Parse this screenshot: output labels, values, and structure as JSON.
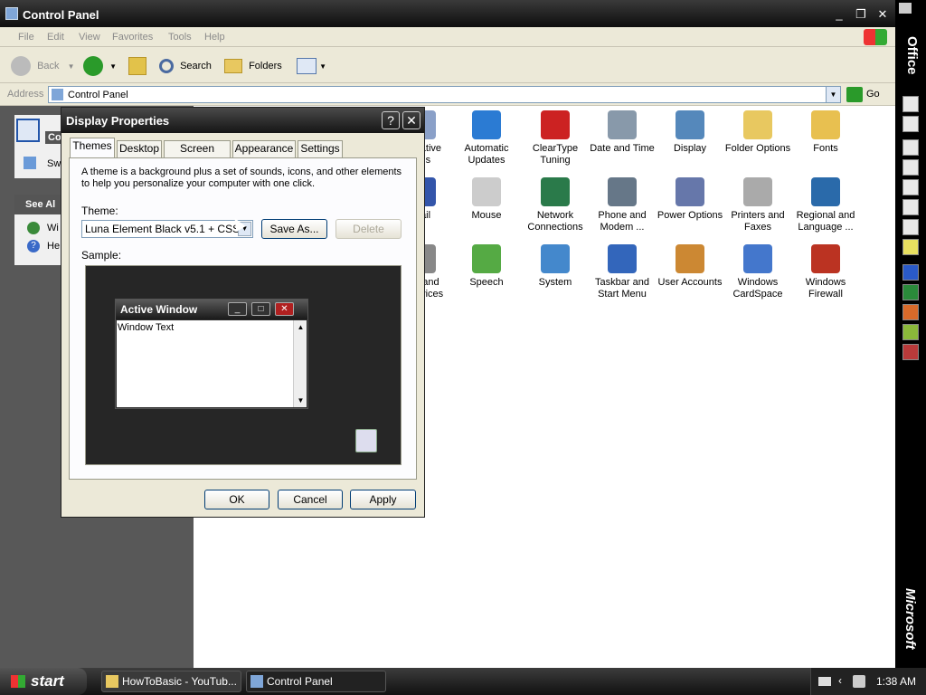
{
  "window": {
    "title": "Control Panel"
  },
  "menu": [
    "File",
    "Edit",
    "View",
    "Favorites",
    "Tools",
    "Help"
  ],
  "toolbar": {
    "back": "Back",
    "search": "Search",
    "folders": "Folders"
  },
  "address": {
    "label": "Address",
    "value": "Control Panel",
    "go": "Go"
  },
  "left_pane": {
    "panel_title": "Co",
    "switch_item": "Sw",
    "see_also": "See Al",
    "links": [
      "Wi",
      "He"
    ]
  },
  "items": [
    {
      "label": "nistrative\nools",
      "icon": "administrative-tools-icon",
      "color": "#8aa0c8"
    },
    {
      "label": "Automatic\nUpdates",
      "icon": "automatic-updates-icon",
      "color": "#2b7bd3"
    },
    {
      "label": "ClearType\nTuning",
      "icon": "cleartype-tuning-icon",
      "color": "#c22"
    },
    {
      "label": "Date and Time",
      "icon": "date-time-icon",
      "color": "#8899aa"
    },
    {
      "label": "Display",
      "icon": "display-icon",
      "color": "#5588bb"
    },
    {
      "label": "Folder Options",
      "icon": "folder-options-icon",
      "color": "#e8c860"
    },
    {
      "label": "Fonts",
      "icon": "fonts-icon",
      "color": "#e8c050"
    },
    {
      "label": "Mail",
      "icon": "mail-icon",
      "color": "#3355aa"
    },
    {
      "label": "Mouse",
      "icon": "mouse-icon",
      "color": "#cccccc"
    },
    {
      "label": "Network\nConnections",
      "icon": "network-connections-icon",
      "color": "#2a7a4a"
    },
    {
      "label": "Phone and\nModem ...",
      "icon": "phone-modem-icon",
      "color": "#667788"
    },
    {
      "label": "Power Options",
      "icon": "power-options-icon",
      "color": "#6677aa"
    },
    {
      "label": "Printers and\nFaxes",
      "icon": "printers-faxes-icon",
      "color": "#aaaaaa"
    },
    {
      "label": "Regional and\nLanguage ...",
      "icon": "regional-language-icon",
      "color": "#2a6aaa"
    },
    {
      "label": "nds and\no Devices",
      "icon": "sounds-devices-icon",
      "color": "#888888"
    },
    {
      "label": "Speech",
      "icon": "speech-icon",
      "color": "#55aa44"
    },
    {
      "label": "System",
      "icon": "system-icon",
      "color": "#4488cc"
    },
    {
      "label": "Taskbar and\nStart Menu",
      "icon": "taskbar-start-menu-icon",
      "color": "#3366bb"
    },
    {
      "label": "User Accounts",
      "icon": "user-accounts-icon",
      "color": "#cc8833"
    },
    {
      "label": "Windows\nCardSpace",
      "icon": "windows-cardspace-icon",
      "color": "#4477cc"
    },
    {
      "label": "Windows\nFirewall",
      "icon": "windows-firewall-icon",
      "color": "#bb3322"
    }
  ],
  "office_bar": {
    "label": "Office",
    "brand": "Microsoft"
  },
  "dialog": {
    "title": "Display Properties",
    "help": "?",
    "close": "✕",
    "tabs": [
      "Themes",
      "Desktop",
      "Screen Saver",
      "Appearance",
      "Settings"
    ],
    "active_tab": "Themes",
    "description": "A theme is a background plus a set of sounds, icons, and other elements to help you personalize your computer with one click.",
    "theme_label": "Theme:",
    "theme_value": "Luna Element Black v5.1 + CSS",
    "save_as": "Save As...",
    "delete": "Delete",
    "sample_label": "Sample:",
    "sample_window_title": "Active Window",
    "sample_window_text": "Window Text",
    "ok": "OK",
    "cancel": "Cancel",
    "apply": "Apply"
  },
  "taskbar": {
    "start": "start",
    "tasks": [
      "HowToBasic - YouTub...",
      "Control Panel"
    ],
    "clock": "1:38 AM"
  }
}
